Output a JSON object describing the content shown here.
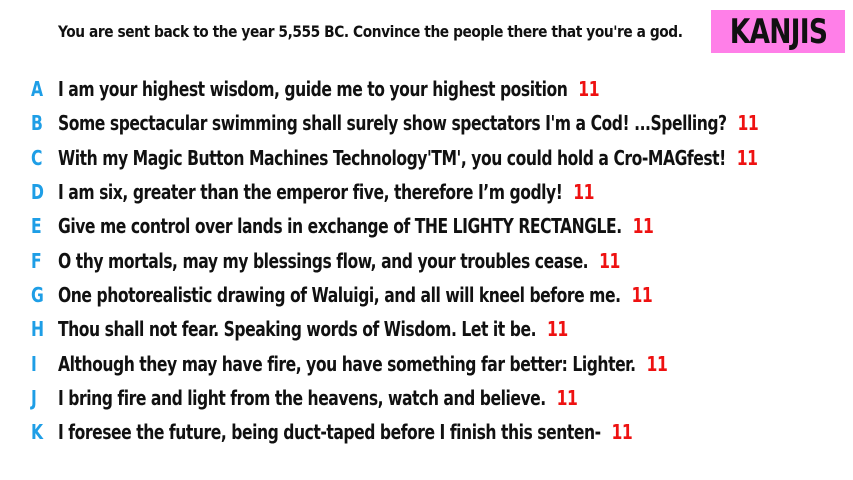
{
  "question": "You are sent back to the year 5,555 BC. Convince the people there that you're a god.",
  "brand": "KANJIS",
  "colors": {
    "brand_background": "#ff7fe8",
    "letter": "#1e9ee6",
    "score": "#ee1111",
    "text": "#111111"
  },
  "answers": [
    {
      "letter": "A",
      "text": "I am your highest wisdom,  guide me to your highest position",
      "score": "11"
    },
    {
      "letter": "B",
      "text": "Some spectacular swimming shall surely show spectators I'm a Cod! ...Spelling?",
      "score": "11"
    },
    {
      "letter": "C",
      "text": "With my Magic Button Machines Technology'TM', you could hold a Cro-MAGfest!",
      "score": "11"
    },
    {
      "letter": "D",
      "text": "I am six, greater than the emperor five, therefore I’m godly!",
      "score": "11"
    },
    {
      "letter": "E",
      "text": "Give me control over lands in exchange of THE LIGHTY RECTANGLE.",
      "score": "11"
    },
    {
      "letter": "F",
      "text": "O thy mortals, may my blessings flow, and your troubles cease.",
      "score": "11"
    },
    {
      "letter": "G",
      "text": "One photorealistic drawing of Waluigi, and all will kneel before me.",
      "score": "11"
    },
    {
      "letter": "H",
      "text": "Thou shall not fear. Speaking words of Wisdom. Let it be.",
      "score": "11"
    },
    {
      "letter": "I",
      "text": "Although they may have fire, you have something far better: Lighter.",
      "score": "11"
    },
    {
      "letter": "J",
      "text": "I bring fire and light from the heavens, watch and believe.",
      "score": "11"
    },
    {
      "letter": "K",
      "text": "I foresee the future, being duct-taped before I finish this senten-",
      "score": "11"
    }
  ]
}
